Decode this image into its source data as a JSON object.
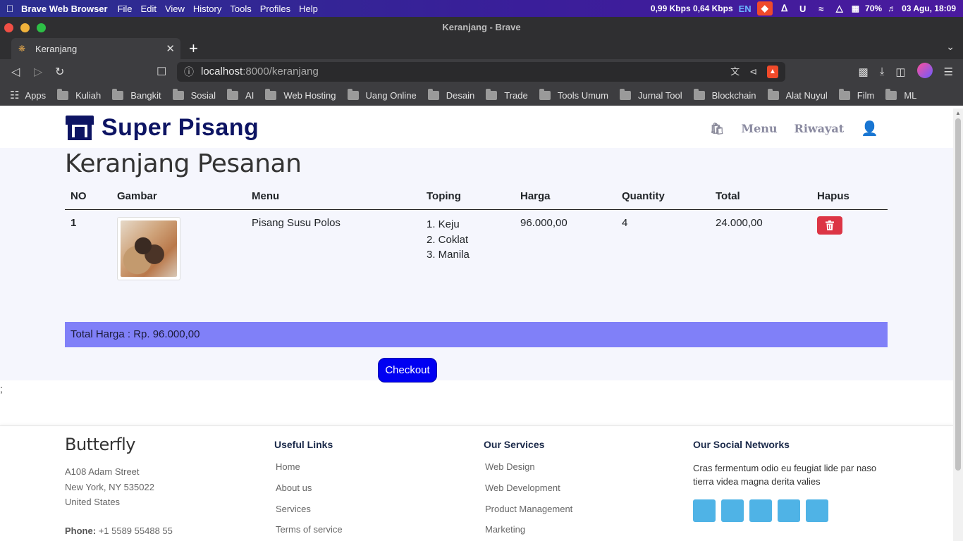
{
  "os": {
    "app_name": "Brave Web Browser",
    "menus": [
      "File",
      "Edit",
      "View",
      "History",
      "Tools",
      "Profiles",
      "Help"
    ],
    "net_speed": "0,99 Kbps 0,64 Kbps",
    "lang": "EN",
    "battery": "70%",
    "datetime": "03 Agu, 18:09"
  },
  "window": {
    "title": "Keranjang - Brave"
  },
  "tab": {
    "title": "Keranjang"
  },
  "url": {
    "host": "localhost",
    "rest": ":8000/keranjang"
  },
  "bookmarks": [
    "Apps",
    "Kuliah",
    "Bangkit",
    "Sosial",
    "AI",
    "Web Hosting",
    "Uang Online",
    "Desain",
    "Trade",
    "Tools Umum",
    "Jurnal Tool",
    "Blockchain",
    "Alat Nuyul",
    "Film",
    "ML"
  ],
  "site": {
    "brand": "Super Pisang",
    "nav": {
      "menu": "Menu",
      "history": "Riwayat"
    },
    "page_title": "Keranjang Pesanan",
    "columns": [
      "NO",
      "Gambar",
      "Menu",
      "Toping",
      "Harga",
      "Quantity",
      "Total",
      "Hapus"
    ],
    "rows": [
      {
        "no": "1",
        "menu": "Pisang Susu Polos",
        "topings": [
          "1. Keju",
          "2. Coklat",
          "3. Manila"
        ],
        "harga": "96.000,00",
        "quantity": "4",
        "total": "24.000,00"
      }
    ],
    "total_harga": "Total Harga : Rp. 96.000,00",
    "checkout_label": "Checkout",
    "stray_text": ";"
  },
  "footer": {
    "brand": "Butterfly",
    "address": [
      "A108 Adam Street",
      "New York, NY 535022",
      "United States"
    ],
    "phone_label": "Phone:",
    "phone": "+1 5589 55488 55",
    "useful_links": {
      "title": "Useful Links",
      "items": [
        "Home",
        "About us",
        "Services",
        "Terms of service"
      ]
    },
    "services": {
      "title": "Our Services",
      "items": [
        "Web Design",
        "Web Development",
        "Product Management",
        "Marketing"
      ]
    },
    "social": {
      "title": "Our Social Networks",
      "text": "Cras fermentum odio eu feugiat lide par naso tierra videa magna derita valies"
    }
  },
  "colors": {
    "brand": "#0d1463",
    "total_bar": "#8080f8",
    "checkout": "#0000f2",
    "delete": "#dc3545",
    "social": "#4fb3e6"
  }
}
